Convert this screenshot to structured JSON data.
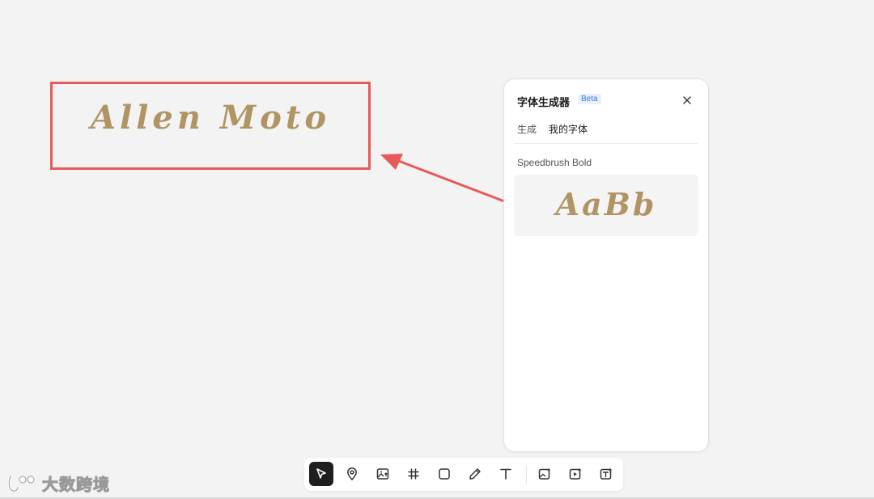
{
  "canvas": {
    "frame_text": "Allen Moto"
  },
  "panel": {
    "title": "字体生成器",
    "badge": "Beta",
    "tabs": [
      {
        "label": "生成",
        "active": false
      },
      {
        "label": "我的字体",
        "active": true
      }
    ],
    "font_name": "Speedbrush Bold",
    "font_sample": "AaBb"
  },
  "toolbar": {
    "tools": [
      {
        "name": "select-tool",
        "icon": "cursor-arrow-icon",
        "active": true
      },
      {
        "name": "location-tool",
        "icon": "map-pin-icon"
      },
      {
        "name": "image-upload-tool",
        "icon": "image-upload-icon"
      },
      {
        "name": "frame-tool",
        "icon": "hash-icon"
      },
      {
        "name": "rectangle-tool",
        "icon": "square-icon"
      },
      {
        "name": "pen-tool",
        "icon": "pencil-icon"
      },
      {
        "name": "text-tool",
        "icon": "text-t-icon"
      },
      {
        "name": "ai-image-tool",
        "icon": "image-sparkle-icon"
      },
      {
        "name": "ai-video-tool",
        "icon": "video-sparkle-icon"
      },
      {
        "name": "ai-text-tool",
        "icon": "text-sparkle-icon"
      }
    ]
  },
  "watermark": {
    "text": "大数跨境"
  },
  "colors": {
    "accent_red": "#e85a5a",
    "font_gold": "#b09463",
    "badge_blue": "#3b7bd8",
    "active_tool_bg": "#1f1f1f"
  }
}
